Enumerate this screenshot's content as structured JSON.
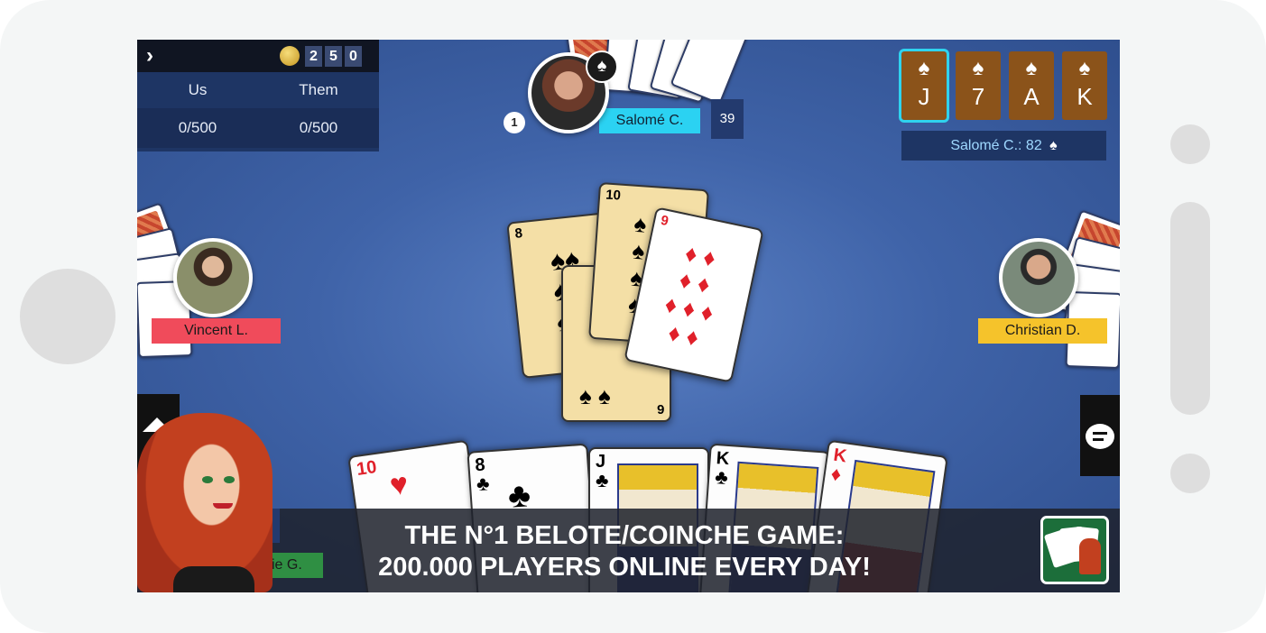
{
  "score_panel": {
    "arrow": "›",
    "coin_digits": [
      "2",
      "5",
      "0"
    ],
    "headers": [
      "Us",
      "Them"
    ],
    "values": [
      "0/500",
      "0/500"
    ]
  },
  "players": {
    "top": {
      "name": "Salomé C.",
      "order_badge": "1",
      "card_count": "39",
      "tag_color": "#2bd2f2",
      "dealer_icon": "spade-icon"
    },
    "left": {
      "name": "Vincent L.",
      "tag_color": "#f04b5b"
    },
    "right": {
      "name": "Christian D.",
      "tag_color": "#f5c32b"
    },
    "bottom": {
      "name": "Lucie G.",
      "tag_color": "#2f8f43"
    }
  },
  "bid": {
    "cards": [
      {
        "suit": "♠",
        "rank": "J"
      },
      {
        "suit": "♠",
        "rank": "7"
      },
      {
        "suit": "♠",
        "rank": "A"
      },
      {
        "suit": "♠",
        "rank": "K"
      }
    ],
    "label": "Salomé C.: 82",
    "label_suit": "♠"
  },
  "trick": [
    {
      "rank": "8",
      "suit": "♠",
      "color": "#000000"
    },
    {
      "rank": "10",
      "suit": "♠",
      "color": "#000000"
    },
    {
      "rank": "6",
      "suit": "♠",
      "color": "#000000"
    },
    {
      "rank": "9",
      "suit": "♦",
      "color": "#e0202a"
    }
  ],
  "hand": [
    {
      "rank": "10",
      "suit": "♥",
      "color": "#e0202a"
    },
    {
      "rank": "8",
      "suit": "♣",
      "color": "#000000"
    },
    {
      "rank": "J",
      "suit": "♣",
      "color": "#000000"
    },
    {
      "rank": "K",
      "suit": "♣",
      "color": "#000000"
    },
    {
      "rank": "K",
      "suit": "♦",
      "color": "#e0202a"
    }
  ],
  "banner": {
    "line1": "THE N°1 BELOTE/COINCHE GAME:",
    "line2": "200.000 PLAYERS ONLINE EVERY DAY!"
  },
  "colors": {
    "table": "#3f63a8",
    "panel": "#1e3564",
    "bid_card": "#8b531a",
    "selected": "#2fd3ee"
  }
}
